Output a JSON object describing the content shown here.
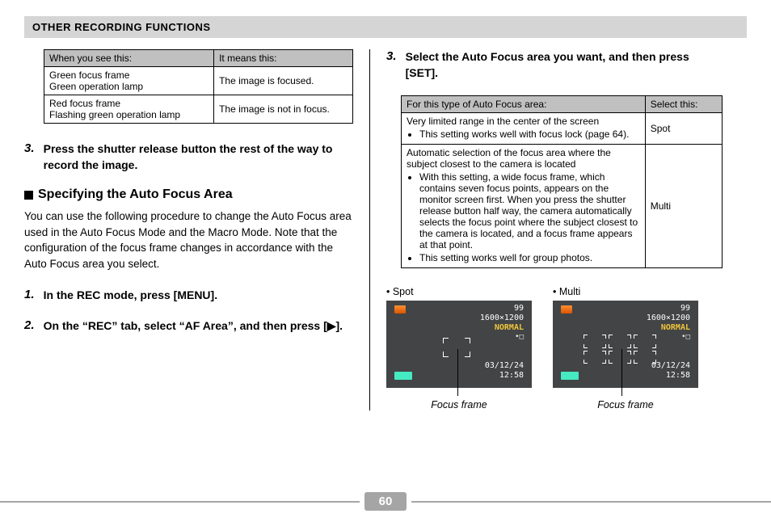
{
  "header": "OTHER RECORDING FUNCTIONS",
  "leftTable": {
    "head": [
      "When you see this:",
      "It means this:"
    ],
    "rows": [
      {
        "c1a": "Green focus frame",
        "c1b": "Green operation lamp",
        "c2": "The image is focused."
      },
      {
        "c1a": "Red focus frame",
        "c1b": "Flashing green operation lamp",
        "c2": "The image is not in focus."
      }
    ]
  },
  "stepL3": {
    "num": "3.",
    "body": "Press the shutter release button the rest of the way to record the image."
  },
  "subhead": "Specifying the Auto Focus Area",
  "para": "You can use the following procedure to change the Auto Focus area used in the Auto Focus Mode and the Macro Mode. Note that the configuration of the focus frame changes in accordance with the Auto Focus area you select.",
  "stepL1": {
    "num": "1.",
    "body": "In the REC mode, press [MENU]."
  },
  "stepL2": {
    "num": "2.",
    "body": "On the “REC” tab, select “AF Area”, and then press [▶]."
  },
  "stepR3": {
    "num": "3.",
    "body": "Select the Auto Focus area you want, and then press [SET]."
  },
  "rightTable": {
    "head": [
      "For this type of Auto Focus area:",
      "Select this:"
    ],
    "row1": {
      "line1": "Very limited range in the center of the screen",
      "bullet1": "This setting works well with focus lock (page 64).",
      "select": "Spot"
    },
    "row2": {
      "line1": "Automatic selection of the focus area where the subject closest to the camera is located",
      "bullet1": "With this setting, a wide focus frame, which contains seven focus points, appears on the monitor screen first.  When you press the shutter release button half way, the camera automatically selects the focus point where the subject closest to the camera is located, and a focus frame appears at that point.",
      "bullet2": "This setting works well for group photos.",
      "select": "Multi"
    }
  },
  "screens": {
    "spotLabel": "• Spot",
    "multiLabel": "• Multi",
    "num99": "99",
    "res": "1600×1200",
    "normal": "NORMAL",
    "iconL": "•□",
    "date": "03/12/24",
    "time": "12:58",
    "caption": "Focus frame"
  },
  "page": "60"
}
